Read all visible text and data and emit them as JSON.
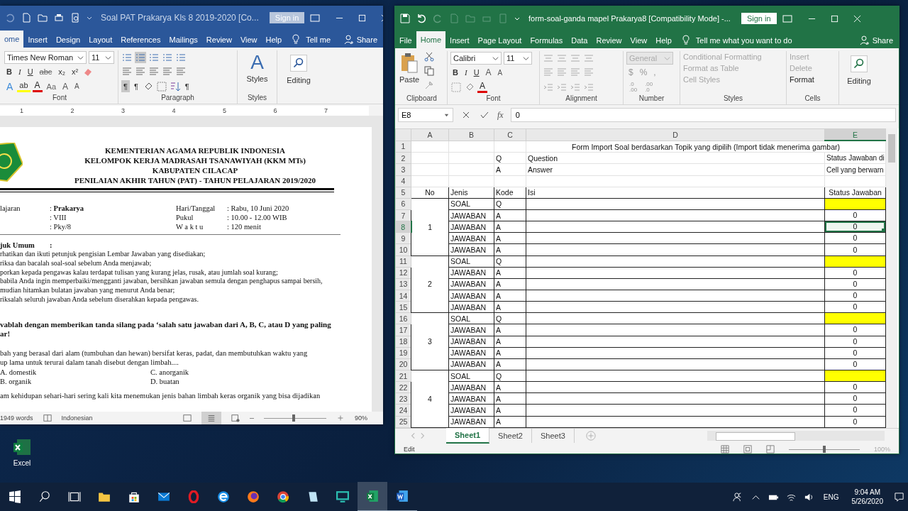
{
  "word": {
    "title": "Soal PAT Prakarya Kls 8 2019-2020 [Co...",
    "sign_in": "Sign in",
    "tabs": [
      {
        "label": "ome",
        "selected": true
      },
      {
        "label": "Insert",
        "selected": false
      },
      {
        "label": "Design",
        "selected": false
      },
      {
        "label": "Layout",
        "selected": false
      },
      {
        "label": "References",
        "selected": false
      },
      {
        "label": "Mailings",
        "selected": false
      },
      {
        "label": "Review",
        "selected": false
      },
      {
        "label": "View",
        "selected": false
      },
      {
        "label": "Help",
        "selected": false
      }
    ],
    "tell_me": "Tell me",
    "share": "Share",
    "font": {
      "name": "Times New Roman",
      "size": "11",
      "label": "Font",
      "row1": [
        "B",
        "I",
        "U",
        "abc",
        "x₂",
        "x²"
      ],
      "row2": [
        {
          "label": "A",
          "kind": "effects"
        },
        {
          "label": "ab",
          "kind": "highlight"
        },
        {
          "label": "A",
          "kind": "color"
        },
        {
          "label": "Aa",
          "kind": "case"
        },
        {
          "label": "A",
          "kind": "grow"
        },
        {
          "label": "A",
          "kind": "shrink"
        }
      ]
    },
    "paragraph": {
      "label": "Paragraph",
      "ltr": "¶",
      "rtl": "¶",
      "show": "¶"
    },
    "styles": {
      "glyph": "A",
      "button": "Styles",
      "label": "Styles"
    },
    "editing": "Editing",
    "ruler": [
      "1",
      "2",
      "3",
      "4",
      "5",
      "6",
      "7"
    ],
    "doc": {
      "header": [
        "KEMENTERIAN AGAMA REPUBLIK INDONESIA",
        "KELOMPOK KERJA MADRASAH TSANAWIYAH (KKM MTs)",
        "KABUPATEN CILACAP",
        "PENILAIAN AKHIR TAHUN (PAT) - TAHUN PELAJARAN 2019/2020"
      ],
      "info": [
        {
          "label": "lajaran",
          "value": ": **Prakarya**",
          "label2": "Hari/Tanggal",
          "value2": ": Rabu, 10 Juni 2020"
        },
        {
          "value": ": VIII",
          "label2": "Pukul",
          "value2": ":  10.00 - 12.00 WIB"
        },
        {
          "value": ": Pky/8",
          "label2": "W a k t u",
          "value2": ":  120 menit"
        }
      ],
      "instructions_title": "juk Umum",
      "instructions_colon": ":",
      "instructions": [
        "rhatikan dan ikuti petunjuk pengisian Lembar Jawaban yang disediakan;",
        "riksa dan bacalah soal-soal sebelum Anda menjawab;",
        "porkan kepada pengawas kalau terdapat tulisan yang kurang jelas, rusak, atau jumlah soal kurang;",
        "babila Anda ingin memperbaiki/mengganti jawaban, bersihkan jawaban semula dengan penghapus sampai bersih,",
        "mudian hitamkan bulatan jawaban yang menurut Anda benar;",
        "riksalah seluruh jawaban Anda sebelum diserahkan kepada pengawas."
      ],
      "task": [
        "vablah dengan memberikan tanda silang pada  ‘salah satu jawaban dari A, B, C, atau D yang paling",
        "ar!"
      ],
      "question": [
        "bah yang berasal dari alam (tumbuhan dan hewan) bersifat keras, padat, dan membutuhkan waktu yang",
        "up lama untuk terurai dalam tanah disebut dengan limbah...."
      ],
      "options": [
        "A. domestik",
        "C. anorganik",
        "B. organik",
        "D. buatan"
      ],
      "next_question": "am kehidupan sehari-hari sering kali kita menemukan jenis bahan limbah keras organik yang bisa dijadikan"
    },
    "status": {
      "words": "1949 words",
      "language": "Indonesian",
      "zoom": "90%",
      "zoom_slider": {
        "level": 0.48
      }
    }
  },
  "excel": {
    "title": "form-soal-ganda mapel Prakarya8  [Compatibility Mode]  -...",
    "sign_in": "Sign in",
    "tabs": [
      {
        "label": "File",
        "selected": false
      },
      {
        "label": "Home",
        "selected": true
      },
      {
        "label": "Insert",
        "selected": false
      },
      {
        "label": "Page Layout",
        "selected": false
      },
      {
        "label": "Formulas",
        "selected": false
      },
      {
        "label": "Data",
        "selected": false
      },
      {
        "label": "Review",
        "selected": false
      },
      {
        "label": "View",
        "selected": false
      },
      {
        "label": "Help",
        "selected": false
      }
    ],
    "tell_me": "Tell me what you want to do",
    "share": "Share",
    "paste": "Paste",
    "font": {
      "name": "Calibri",
      "size": "11",
      "row1": [
        "B",
        "I",
        "U"
      ],
      "color_letter": "A",
      "grow": "A",
      "shrink": "A"
    },
    "number": {
      "format": "General",
      "symbols": [
        "$",
        "%",
        ","
      ],
      "decimals": [
        {
          "top": ".0",
          "bottom": ".00"
        },
        {
          "top": ".00",
          "bottom": ".0"
        }
      ]
    },
    "styles_buttons": [
      {
        "label": "Conditional Formatting",
        "disabled": true
      },
      {
        "label": "Format as Table",
        "disabled": true
      },
      {
        "label": "Cell Styles",
        "disabled": true
      }
    ],
    "cells_buttons": [
      {
        "label": "Insert",
        "disabled": true
      },
      {
        "label": "Delete",
        "disabled": true
      },
      {
        "label": "Format",
        "disabled": false
      }
    ],
    "editing": "Editing",
    "group_labels": [
      "Clipboard",
      "Font",
      "Alignment",
      "Number",
      "Styles",
      "Cells"
    ],
    "name_box": "E8",
    "fx": "fx",
    "formula": "0",
    "columns": [
      {
        "label": "A",
        "selected": false
      },
      {
        "label": "B",
        "selected": false
      },
      {
        "label": "C",
        "selected": false
      },
      {
        "label": "D",
        "selected": false
      },
      {
        "label": "E",
        "selected": true
      }
    ],
    "top_rows": [
      {
        "num": "1",
        "kind": "title",
        "title": "Form Import Soal berdasarkan Topik yang dipilih (Import tidak menerima gambar)"
      },
      {
        "num": "2",
        "kind": "note",
        "kode": "Q",
        "isi": "Question",
        "status": "Status Jawaban di"
      },
      {
        "num": "3",
        "kind": "note",
        "kode": "A",
        "isi": "Answer",
        "status": "Cell yang berwarn"
      },
      {
        "num": "4",
        "kind": "blank"
      },
      {
        "num": "5",
        "kind": "header",
        "no": "No",
        "jenis": "Jenis",
        "kode": "Kode",
        "isi": "Isi",
        "status": "Status Jawaban"
      }
    ],
    "groups": [
      {
        "no": "1",
        "rows": [
          {
            "num": "6",
            "jenis": "SOAL",
            "kode": "Q",
            "highlight": true,
            "selected": false
          },
          {
            "num": "7",
            "jenis": "JAWABAN",
            "kode": "A",
            "status": "0",
            "highlight": false,
            "selected": false
          },
          {
            "num": "8",
            "jenis": "JAWABAN",
            "kode": "A",
            "status": "0",
            "highlight": false,
            "selected": true
          },
          {
            "num": "9",
            "jenis": "JAWABAN",
            "kode": "A",
            "status": "0",
            "highlight": false,
            "selected": false
          },
          {
            "num": "10",
            "jenis": "JAWABAN",
            "kode": "A",
            "status": "0",
            "highlight": false,
            "selected": false
          }
        ]
      },
      {
        "no": "2",
        "rows": [
          {
            "num": "11",
            "jenis": "SOAL",
            "kode": "Q",
            "highlight": true,
            "selected": false
          },
          {
            "num": "12",
            "jenis": "JAWABAN",
            "kode": "A",
            "status": "0",
            "highlight": false,
            "selected": false
          },
          {
            "num": "13",
            "jenis": "JAWABAN",
            "kode": "A",
            "status": "0",
            "highlight": false,
            "selected": false
          },
          {
            "num": "14",
            "jenis": "JAWABAN",
            "kode": "A",
            "status": "0",
            "highlight": false,
            "selected": false
          },
          {
            "num": "15",
            "jenis": "JAWABAN",
            "kode": "A",
            "status": "0",
            "highlight": false,
            "selected": false
          }
        ]
      },
      {
        "no": "3",
        "rows": [
          {
            "num": "16",
            "jenis": "SOAL",
            "kode": "Q",
            "highlight": true,
            "selected": false
          },
          {
            "num": "17",
            "jenis": "JAWABAN",
            "kode": "A",
            "status": "0",
            "highlight": false,
            "selected": false
          },
          {
            "num": "18",
            "jenis": "JAWABAN",
            "kode": "A",
            "status": "0",
            "highlight": false,
            "selected": false
          },
          {
            "num": "19",
            "jenis": "JAWABAN",
            "kode": "A",
            "status": "0",
            "highlight": false,
            "selected": false
          },
          {
            "num": "20",
            "jenis": "JAWABAN",
            "kode": "A",
            "status": "0",
            "highlight": false,
            "selected": false
          }
        ]
      },
      {
        "no": "4",
        "rows": [
          {
            "num": "21",
            "jenis": "SOAL",
            "kode": "Q",
            "highlight": true,
            "selected": false
          },
          {
            "num": "22",
            "jenis": "JAWABAN",
            "kode": "A",
            "status": "0",
            "highlight": false,
            "selected": false
          },
          {
            "num": "23",
            "jenis": "JAWABAN",
            "kode": "A",
            "status": "0",
            "highlight": false,
            "selected": false
          },
          {
            "num": "24",
            "jenis": "JAWABAN",
            "kode": "A",
            "status": "0",
            "highlight": false,
            "selected": false
          },
          {
            "num": "25",
            "jenis": "JAWABAN",
            "kode": "A",
            "status": "0",
            "highlight": false,
            "selected": false
          }
        ]
      }
    ],
    "sheets": [
      {
        "label": "Sheet1",
        "selected": true
      },
      {
        "label": "Sheet2",
        "selected": false
      },
      {
        "label": "Sheet3",
        "selected": false
      }
    ],
    "status": {
      "mode": "Edit",
      "zoom": "100%",
      "zoom_slider": {
        "level": 0.5
      }
    }
  },
  "desktop_icon": "Excel",
  "taskbar": {
    "language": "ENG",
    "time": "9:04 AM",
    "date": "5/26/2020"
  }
}
